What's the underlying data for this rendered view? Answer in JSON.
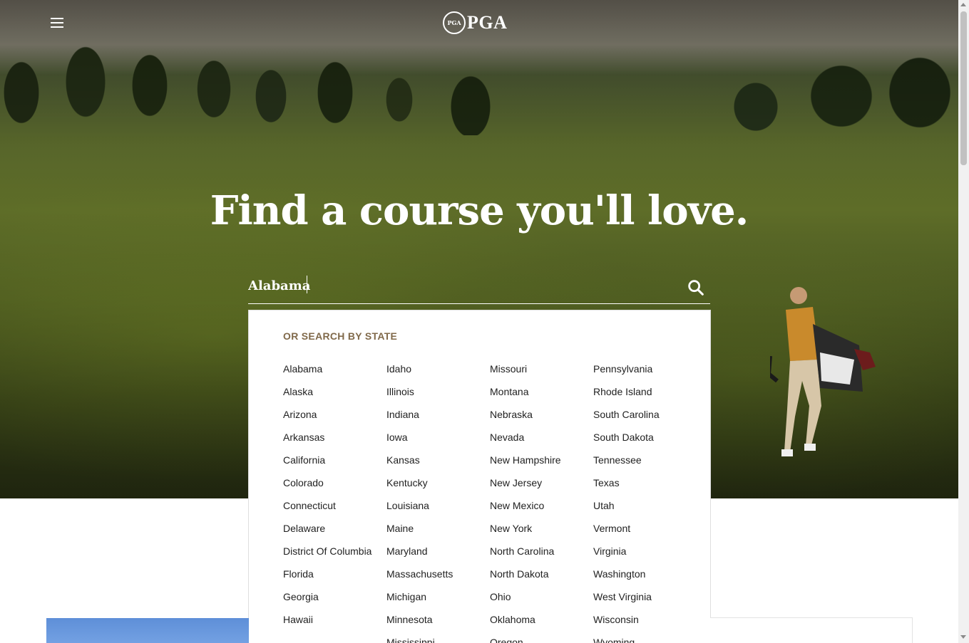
{
  "header": {
    "menu_icon": "hamburger-menu-icon",
    "logo_seal_text": "PGA",
    "logo_text": "PGA"
  },
  "hero": {
    "title": "Find a course you'll love."
  },
  "search": {
    "value": "Alabama",
    "button_icon": "search-icon"
  },
  "dropdown": {
    "heading": "OR SEARCH BY STATE",
    "columns": [
      [
        "Alabama",
        "Alaska",
        "Arizona",
        "Arkansas",
        "California",
        "Colorado",
        "Connecticut",
        "Delaware",
        "District Of Columbia",
        "Florida",
        "Georgia",
        "Hawaii"
      ],
      [
        "Idaho",
        "Illinois",
        "Indiana",
        "Iowa",
        "Kansas",
        "Kentucky",
        "Louisiana",
        "Maine",
        "Maryland",
        "Massachusetts",
        "Michigan",
        "Minnesota",
        "Mississippi"
      ],
      [
        "Missouri",
        "Montana",
        "Nebraska",
        "Nevada",
        "New Hampshire",
        "New Jersey",
        "New Mexico",
        "New York",
        "North Carolina",
        "North Dakota",
        "Ohio",
        "Oklahoma",
        "Oregon"
      ],
      [
        "Pennsylvania",
        "Rhode Island",
        "South Carolina",
        "South Dakota",
        "Tennessee",
        "Texas",
        "Utah",
        "Vermont",
        "Virginia",
        "Washington",
        "West Virginia",
        "Wisconsin",
        "Wyoming"
      ]
    ]
  },
  "colors": {
    "accent": "#80694a",
    "text": "#1f1f1f",
    "hero_text": "#ffffff"
  }
}
